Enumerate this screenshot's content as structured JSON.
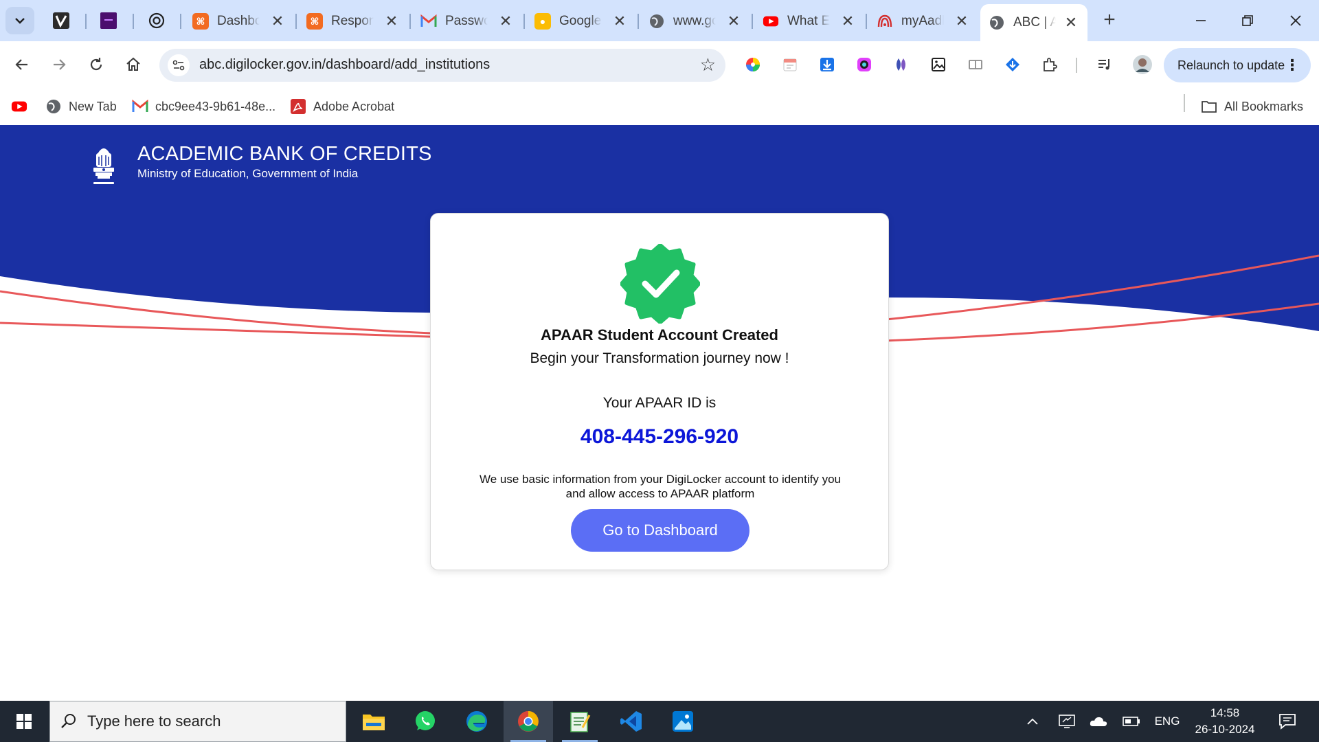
{
  "browser": {
    "tabs": [
      {
        "label": "Dashbo",
        "icon": "xampp-icon",
        "color": "#f26b21"
      },
      {
        "label": "Respon",
        "icon": "xampp-icon",
        "color": "#f26b21"
      },
      {
        "label": "Passwo",
        "icon": "gmail-icon",
        "color": "#ea4335"
      },
      {
        "label": "Google",
        "icon": "google-keep-icon",
        "color": "#fbbc04"
      },
      {
        "label": "www.gc",
        "icon": "globe-icon",
        "color": "#5f6368"
      },
      {
        "label": "What E",
        "icon": "youtube-icon",
        "color": "#ff0000"
      },
      {
        "label": "myAadh",
        "icon": "aadhaar-icon",
        "color": "#d32f2f"
      },
      {
        "label": "ABC | A",
        "icon": "globe-icon",
        "color": "#5f6368",
        "active": true
      }
    ],
    "url": "abc.digilocker.gov.in/dashboard/add_institutions",
    "relaunch_label": "Relaunch to update",
    "bookmarks": [
      {
        "label": "New Tab",
        "icon": "globe-icon"
      },
      {
        "label": "cbc9ee43-9b61-48e...",
        "icon": "gmail-icon"
      },
      {
        "label": "Adobe Acrobat",
        "icon": "acrobat-icon"
      }
    ],
    "all_bookmarks_label": "All Bookmarks"
  },
  "site": {
    "title": "ACADEMIC BANK OF CREDITS",
    "subtitle": "Ministry of Education, Government of India",
    "emblem_caption": "सत्यमेव जयते",
    "banner_color": "#1a30a3",
    "accent_line_color": "#e8585a"
  },
  "card": {
    "title": "APAAR Student Account Created",
    "subtitle": "Begin your Transformation journey now !",
    "id_label": "Your APAAR ID is",
    "id_value": "408-445-296-920",
    "info": "We use basic information from your DigiLocker account to identify you and allow access to APAAR platform",
    "button_label": "Go to Dashboard",
    "badge_color": "#22c065"
  },
  "taskbar": {
    "search_placeholder": "Type here to search",
    "language": "ENG",
    "time": "14:58",
    "date": "26-10-2024"
  }
}
